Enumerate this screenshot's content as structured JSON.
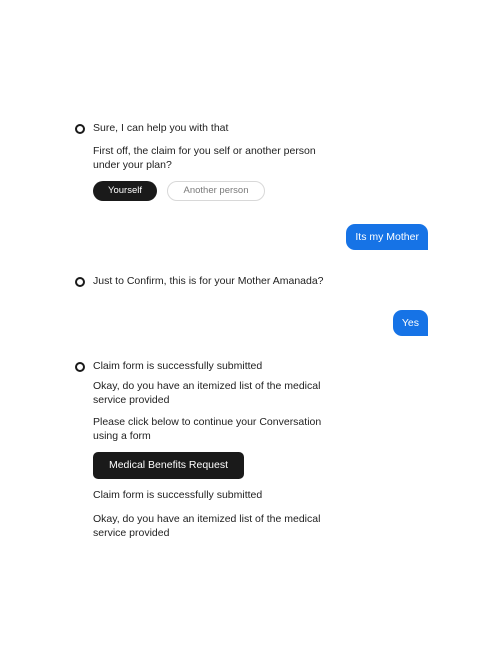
{
  "conversation": {
    "block1": {
      "greeting": "Sure, I can help you with that",
      "question": "First off, the claim for you self or another person under your plan?",
      "options": [
        "Yourself",
        "Another person"
      ]
    },
    "user_reply_1": "Its my Mother",
    "block2": {
      "confirm": "Just to Confirm, this is for your Mother Amanada?"
    },
    "user_reply_2": "Yes",
    "block3": {
      "submitted": "Claim form is successfully submitted",
      "itemized": "Okay, do you have an itemized list of the medical service provided",
      "continue": "Please click below to continue your Conversation using a form",
      "form_button": "Medical Benefits Request",
      "submitted_again": "Claim form is successfully submitted",
      "itemized_again": "Okay, do you have an itemized list of the medical service provided"
    }
  },
  "colors": {
    "user_bubble": "#1673e6",
    "dark_button": "#1a1a1a"
  },
  "icons": {
    "bot_avatar": "ring-icon"
  }
}
